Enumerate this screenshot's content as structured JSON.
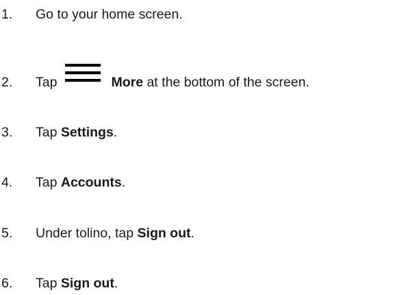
{
  "steps": [
    {
      "number": "1.",
      "text": "Go to your home screen."
    },
    {
      "number": "2.",
      "pre": "Tap",
      "icon": "menu-icon",
      "bold": "More",
      "post": " at the bottom of the screen."
    },
    {
      "number": "3.",
      "pre": "Tap ",
      "bold": "Settings",
      "post": "."
    },
    {
      "number": "4.",
      "pre": "Tap ",
      "bold": "Accounts",
      "post": "."
    },
    {
      "number": "5.",
      "pre": "Under tolino, tap ",
      "bold": "Sign out",
      "post": "."
    },
    {
      "number": "6.",
      "pre": "Tap ",
      "bold": "Sign out",
      "post": "."
    }
  ]
}
